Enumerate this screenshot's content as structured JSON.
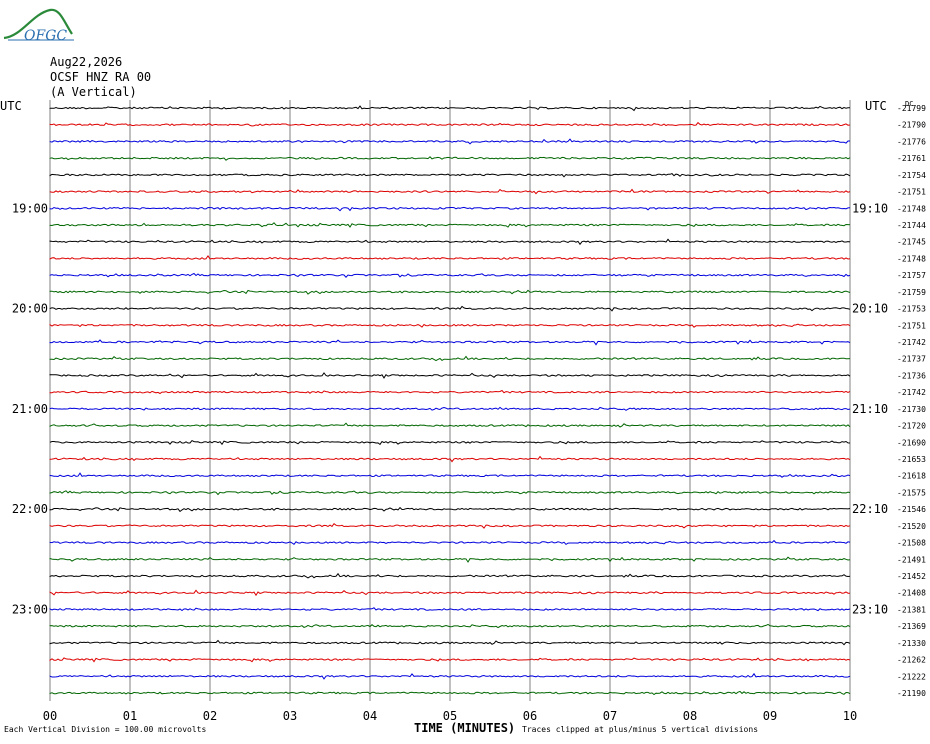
{
  "header": {
    "date": "Aug22,2026",
    "station": "OCSF HNZ RA 00",
    "component": "(A Vertical)"
  },
  "logo_text": "OFGC",
  "colors": {
    "black": "#000000",
    "red": "#dd0000",
    "blue": "#0000dd",
    "green": "#006600",
    "grid": "#808080"
  },
  "chart_data": {
    "type": "line",
    "title": "",
    "xlabel": "TIME (MINUTES)",
    "x_ticks": [
      "00",
      "01",
      "02",
      "03",
      "04",
      "05",
      "06",
      "07",
      "08",
      "09",
      "10"
    ],
    "xlim": [
      0,
      10
    ],
    "left_corner_label": "UTC",
    "right_corner_label": "UTC",
    "right_header_label": "DC",
    "left_time_labels": [
      {
        "row": 6,
        "text": "19:00"
      },
      {
        "row": 12,
        "text": "20:00"
      },
      {
        "row": 18,
        "text": "21:00"
      },
      {
        "row": 24,
        "text": "22:00"
      },
      {
        "row": 30,
        "text": "23:00"
      }
    ],
    "right_time_labels": [
      {
        "row": 6,
        "text": "19:10"
      },
      {
        "row": 12,
        "text": "20:10"
      },
      {
        "row": 18,
        "text": "21:10"
      },
      {
        "row": 24,
        "text": "22:10"
      },
      {
        "row": 30,
        "text": "23:10"
      }
    ],
    "trace_colors": [
      "black",
      "red",
      "blue",
      "green"
    ],
    "dc_offsets": [
      -21799,
      -21790,
      -21776,
      -21761,
      -21754,
      -21751,
      -21748,
      -21744,
      -21745,
      -21748,
      -21757,
      -21759,
      -21753,
      -21751,
      -21742,
      -21737,
      -21736,
      -21742,
      -21730,
      -21720,
      -21690,
      -21653,
      -21618,
      -21575,
      -21546,
      -21520,
      -21508,
      -21491,
      -21452,
      -21408,
      -21381,
      -21369,
      -21330,
      -21262,
      -21222,
      -21190
    ],
    "scale_note": "Each Vertical Division =  100.00 microvolts",
    "clip_note": "Traces clipped at plus/minus 5 vertical divisions"
  }
}
